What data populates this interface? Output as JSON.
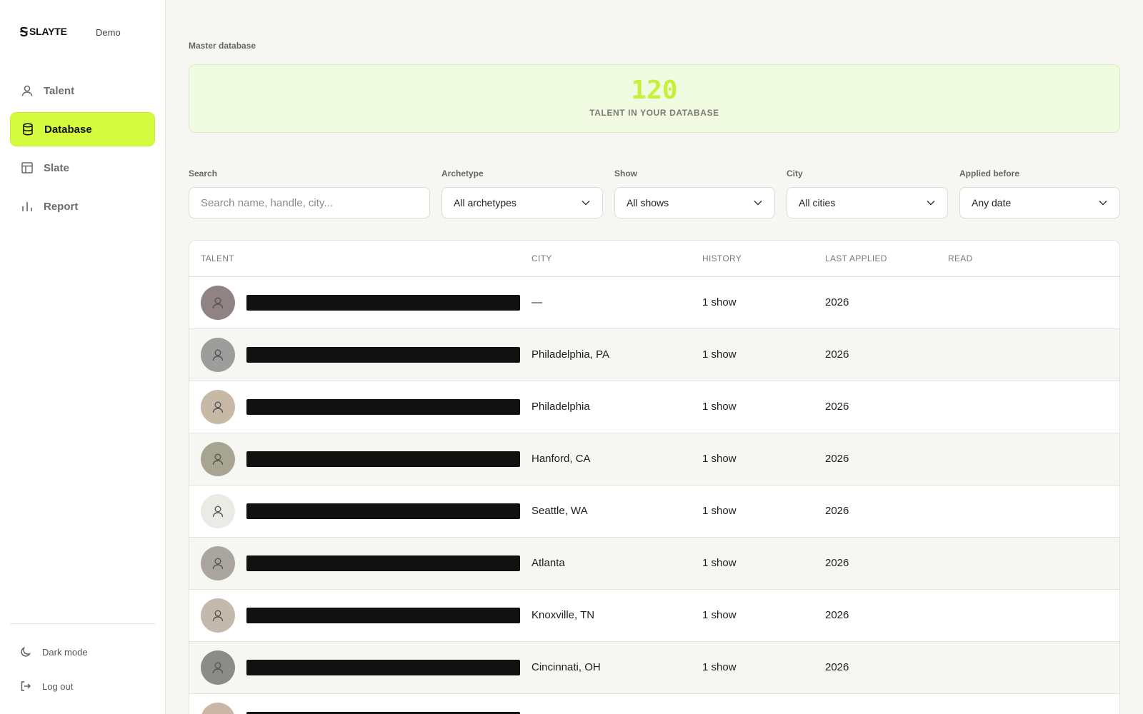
{
  "brand": {
    "logo": "SLAYTE",
    "env": "Demo"
  },
  "sidebar": {
    "items": [
      {
        "label": "Talent",
        "icon": "user-icon"
      },
      {
        "label": "Database",
        "icon": "database-icon",
        "active": true
      },
      {
        "label": "Slate",
        "icon": "layout-icon"
      },
      {
        "label": "Report",
        "icon": "bar-chart-icon"
      }
    ],
    "footer": [
      {
        "label": "Dark mode",
        "icon": "moon-icon"
      },
      {
        "label": "Log out",
        "icon": "logout-icon"
      }
    ]
  },
  "main": {
    "section_label": "Master database",
    "stat": {
      "value": "120",
      "caption": "TALENT IN YOUR DATABASE"
    },
    "filters": {
      "search": {
        "label": "Search",
        "placeholder": "Search name, handle, city..."
      },
      "archetype": {
        "label": "Archetype",
        "value": "All archetypes"
      },
      "show": {
        "label": "Show",
        "value": "All shows"
      },
      "city": {
        "label": "City",
        "value": "All cities"
      },
      "applied_before": {
        "label": "Applied before",
        "value": "Any date"
      }
    },
    "table": {
      "columns": [
        "TALENT",
        "CITY",
        "HISTORY",
        "LAST APPLIED",
        "READ"
      ],
      "rows": [
        {
          "city": "—",
          "history": "1 show",
          "last_applied": "2026",
          "avatar_color": "#8f8383"
        },
        {
          "city": "Philadelphia, PA",
          "history": "1 show",
          "last_applied": "2026",
          "avatar_color": "#9d9d9b"
        },
        {
          "city": "Philadelphia",
          "history": "1 show",
          "last_applied": "2026",
          "avatar_color": "#c7b9a6"
        },
        {
          "city": "Hanford, CA",
          "history": "1 show",
          "last_applied": "2026",
          "avatar_color": "#a7a592"
        },
        {
          "city": "Seattle, WA",
          "history": "1 show",
          "last_applied": "2026",
          "avatar_color": "#ebebe6"
        },
        {
          "city": "Atlanta",
          "history": "1 show",
          "last_applied": "2026",
          "avatar_color": "#aaa69f"
        },
        {
          "city": "Knoxville, TN",
          "history": "1 show",
          "last_applied": "2026",
          "avatar_color": "#c4b9ac"
        },
        {
          "city": "Cincinnati, OH",
          "history": "1 show",
          "last_applied": "2026",
          "avatar_color": "#8c8c87"
        },
        {
          "city": "",
          "history": "",
          "last_applied": "",
          "avatar_color": "#c9b6a6"
        }
      ]
    }
  }
}
